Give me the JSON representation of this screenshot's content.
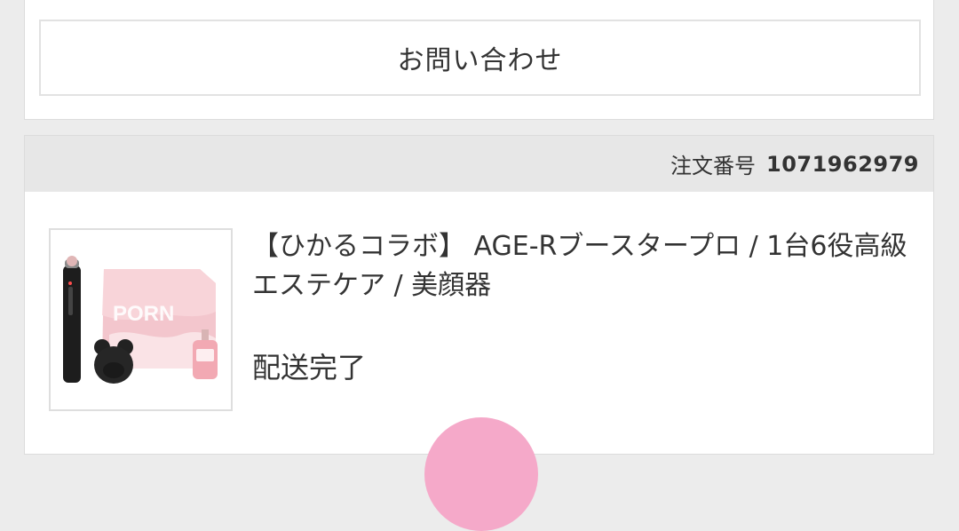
{
  "inquiry": {
    "label": "お問い合わせ"
  },
  "order": {
    "number_label": "注文番号",
    "number_value": "1071962979",
    "product": {
      "title": "【ひかるコラボ】 AGE-Rブースタープロ / 1台6役高級エステケア / 美顔器",
      "image_text": "PORN",
      "status": "配送完了"
    }
  },
  "colors": {
    "header_bg": "#e7e7e7",
    "page_bg": "#ececec",
    "accent_pink": "#f5a9c9"
  }
}
